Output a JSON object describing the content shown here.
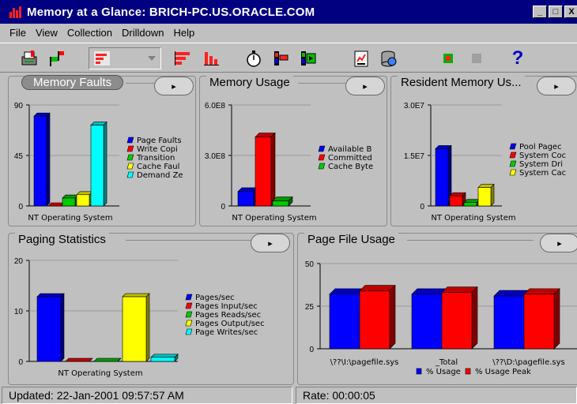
{
  "window": {
    "title": "Memory at a Glance: BRICH-PC.US.ORACLE.COM",
    "min": "_",
    "max": "□",
    "close": "X"
  },
  "menu": [
    "File",
    "View",
    "Collection",
    "Drilldown",
    "Help"
  ],
  "toolbar": {
    "icons": [
      "print-icon",
      "flag-icon",
      "chart-type-selector",
      "bar-chart-icon",
      "column-chart-icon",
      "stopwatch-icon",
      "indicator-icon",
      "indicator-play-icon",
      "report-icon",
      "database-icon",
      "record-icon",
      "stop-icon",
      "help-icon"
    ],
    "help_glyph": "?"
  },
  "panels": {
    "memory_faults": {
      "title": "Memory Faults",
      "drill": "▸"
    },
    "memory_usage": {
      "title": "Memory Usage",
      "drill": "▸"
    },
    "resident": {
      "title": "Resident Memory Us...",
      "drill": "▸"
    },
    "paging": {
      "title": "Paging Statistics",
      "drill": "▸"
    },
    "pagefile": {
      "title": "Page File Usage",
      "drill": "▸"
    }
  },
  "chart_data": [
    {
      "id": "memory_faults",
      "type": "bar",
      "yticks": [
        "90",
        "45",
        "0"
      ],
      "ylim": [
        0,
        90
      ],
      "category": "NT Operating System",
      "series": [
        {
          "name": "Page Faults",
          "value": 80,
          "color": "#0000ff"
        },
        {
          "name": "Write Copi",
          "value": 0,
          "color": "#ff0000"
        },
        {
          "name": "Transition",
          "value": 7,
          "color": "#00cc00"
        },
        {
          "name": "Cache Faul",
          "value": 10,
          "color": "#ffff00"
        },
        {
          "name": "Demand Ze",
          "value": 72,
          "color": "#00ffff"
        }
      ]
    },
    {
      "id": "memory_usage",
      "type": "bar",
      "yticks": [
        "6.0E8",
        "3.0E8",
        "0"
      ],
      "ylim": [
        0,
        600000000
      ],
      "category": "NT Operating System",
      "series": [
        {
          "name": "Available B",
          "value": 85000000,
          "color": "#0000ff"
        },
        {
          "name": "Committed",
          "value": 410000000,
          "color": "#ff0000"
        },
        {
          "name": "Cache Byte",
          "value": 30000000,
          "color": "#00cc00"
        }
      ]
    },
    {
      "id": "resident",
      "type": "bar",
      "yticks": [
        "3.0E7",
        "1.5E7",
        "0"
      ],
      "ylim": [
        0,
        30000000
      ],
      "category": "NT Operating System",
      "series": [
        {
          "name": "Pool Pagec",
          "value": 17000000,
          "color": "#0000ff"
        },
        {
          "name": "System Coc",
          "value": 3000000,
          "color": "#ff0000"
        },
        {
          "name": "System Dri",
          "value": 1000000,
          "color": "#00cc00"
        },
        {
          "name": "System Cac",
          "value": 5500000,
          "color": "#ffff00"
        }
      ]
    },
    {
      "id": "paging",
      "type": "bar",
      "yticks": [
        "20",
        "10",
        "0"
      ],
      "ylim": [
        0,
        20
      ],
      "category": "NT Operating System",
      "series": [
        {
          "name": "Pages/sec",
          "value": 12.8,
          "color": "#0000ff"
        },
        {
          "name": "Pages Input/sec",
          "value": 0,
          "color": "#ff0000"
        },
        {
          "name": "Pages Reads/sec",
          "value": 0,
          "color": "#00cc00"
        },
        {
          "name": "Pages Output/sec",
          "value": 12.8,
          "color": "#ffff00"
        },
        {
          "name": "Page Writes/sec",
          "value": 0.8,
          "color": "#00ffff"
        }
      ]
    },
    {
      "id": "pagefile",
      "type": "grouped-bar",
      "yticks": [
        "50",
        "25",
        "0"
      ],
      "ylim": [
        0,
        50
      ],
      "categories": [
        "\\??\\I:\\pagefile.sys",
        "_Total",
        "\\??\\D:\\pagefile.sys"
      ],
      "series": [
        {
          "name": "% Usage",
          "values": [
            32,
            32,
            31
          ],
          "color": "#0000ff"
        },
        {
          "name": "% Usage Peak",
          "values": [
            34,
            33,
            32
          ],
          "color": "#ff0000"
        }
      ]
    }
  ],
  "status": {
    "updated": "Updated: 22-Jan-2001 09:57:57 AM",
    "rate": "Rate: 00:00:05"
  }
}
